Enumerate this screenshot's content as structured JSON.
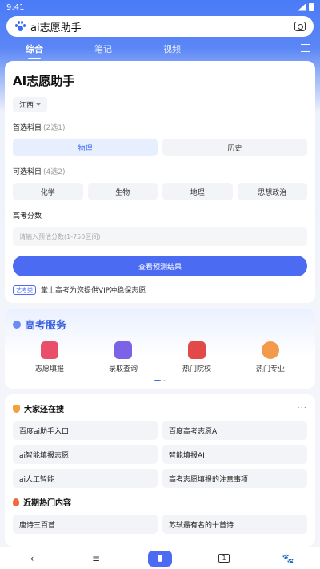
{
  "status": {
    "time": "9:41"
  },
  "search": {
    "query": "ai志愿助手"
  },
  "tabs": [
    "综合",
    "笔记",
    "视频"
  ],
  "card": {
    "title": "AI志愿助手",
    "province": "江西",
    "required": {
      "label": "首选科目",
      "hint": "(2选1)",
      "options": [
        "物理",
        "历史"
      ]
    },
    "optional": {
      "label": "可选科目",
      "hint": "(4选2)",
      "options": [
        "化学",
        "生物",
        "地理",
        "思想政治"
      ]
    },
    "score": {
      "label": "高考分数",
      "placeholder": "请输入预估分数(1-750区间)"
    },
    "submit": "查看预测结果",
    "ad_tag": "艺考类",
    "ad_text": "掌上高考为您提供VIP冲稳保志愿"
  },
  "services": {
    "title": "高考服务",
    "items": [
      {
        "label": "志愿填报",
        "icon": "report-icon",
        "color": "#e94f6a"
      },
      {
        "label": "录取查询",
        "icon": "mail-icon",
        "color": "#7b62e6"
      },
      {
        "label": "热门院校",
        "icon": "school-icon",
        "color": "#e24a4a"
      },
      {
        "label": "热门专业",
        "icon": "medal-icon",
        "color": "#f29a4a"
      }
    ]
  },
  "searching": {
    "title": "大家还在搜",
    "more": "···",
    "items": [
      "百度ai助手入口",
      "百度高考志愿AI",
      "ai智能填报志愿",
      "智能填报AI",
      "ai人工智能",
      "高考志愿填报的注意事项"
    ]
  },
  "hot": {
    "title": "近期热门内容",
    "items": [
      "唐诗三百首",
      "苏轼最有名的十首诗"
    ]
  },
  "nav": [
    "‹",
    "≡",
    "mic",
    "1",
    "paw"
  ]
}
